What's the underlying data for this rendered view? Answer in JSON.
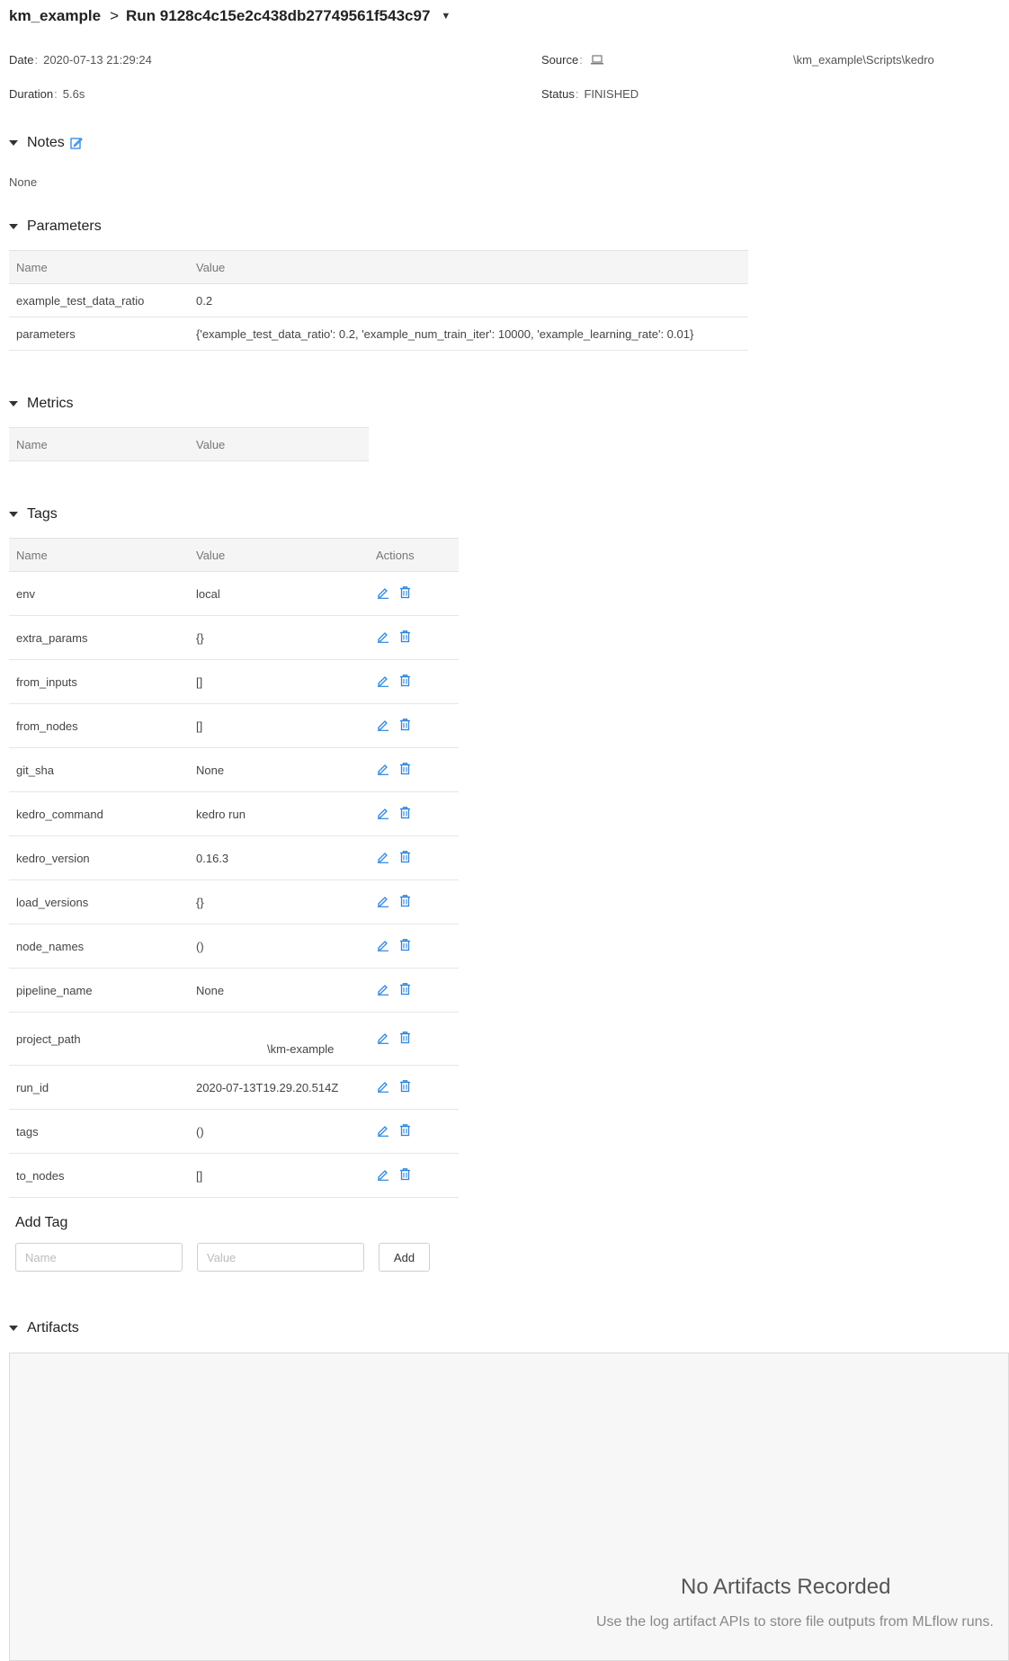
{
  "breadcrumb": {
    "experiment": "km_example",
    "separator": ">",
    "run": "Run 9128c4c15e2c438db27749561f543c97"
  },
  "meta": {
    "date_label": "Date",
    "date_value": "2020-07-13 21:29:24",
    "duration_label": "Duration",
    "duration_value": "5.6s",
    "source_label": "Source",
    "source_value": "\\km_example\\Scripts\\kedro",
    "status_label": "Status",
    "status_value": "FINISHED"
  },
  "notes": {
    "title": "Notes",
    "content": "None"
  },
  "parameters": {
    "title": "Parameters",
    "headers": [
      "Name",
      "Value"
    ],
    "rows": [
      {
        "name": "example_test_data_ratio",
        "value": "0.2"
      },
      {
        "name": "parameters",
        "value": "{'example_test_data_ratio': 0.2, 'example_num_train_iter': 10000, 'example_learning_rate': 0.01}"
      }
    ]
  },
  "metrics": {
    "title": "Metrics",
    "headers": [
      "Name",
      "Value"
    ]
  },
  "tags": {
    "title": "Tags",
    "headers": [
      "Name",
      "Value",
      "Actions"
    ],
    "rows": [
      {
        "name": "env",
        "value": "local"
      },
      {
        "name": "extra_params",
        "value": "{}"
      },
      {
        "name": "from_inputs",
        "value": "[]"
      },
      {
        "name": "from_nodes",
        "value": "[]"
      },
      {
        "name": "git_sha",
        "value": "None"
      },
      {
        "name": "kedro_command",
        "value": "kedro run"
      },
      {
        "name": "kedro_version",
        "value": "0.16.3"
      },
      {
        "name": "load_versions",
        "value": "{}"
      },
      {
        "name": "node_names",
        "value": "()"
      },
      {
        "name": "pipeline_name",
        "value": "None"
      },
      {
        "name": "project_path",
        "value": "\\km-example"
      },
      {
        "name": "run_id",
        "value": "2020-07-13T19.29.20.514Z"
      },
      {
        "name": "tags",
        "value": "()"
      },
      {
        "name": "to_nodes",
        "value": "[]"
      }
    ]
  },
  "add_tag": {
    "title": "Add Tag",
    "name_placeholder": "Name",
    "value_placeholder": "Value",
    "button_label": "Add"
  },
  "artifacts": {
    "title": "Artifacts",
    "empty_title": "No Artifacts Recorded",
    "empty_subtitle": "Use the log artifact APIs to store file outputs from MLflow runs."
  },
  "colors": {
    "icon_blue": "#2e86de",
    "header_bg": "#f5f5f5"
  }
}
